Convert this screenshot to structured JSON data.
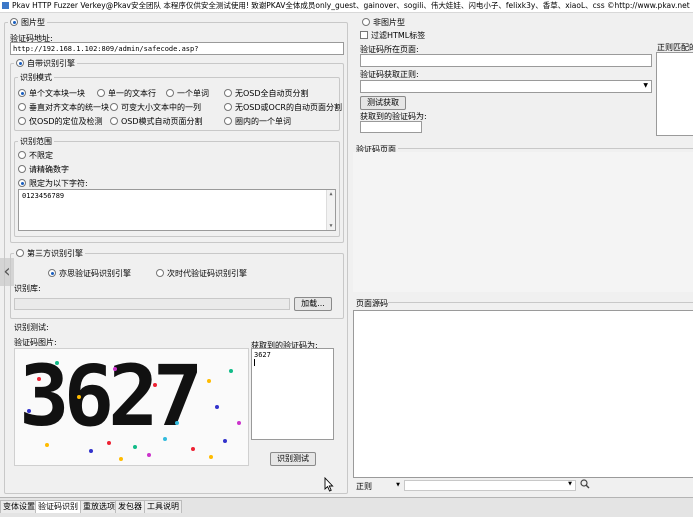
{
  "title_bar": "Pkav HTTP Fuzzer   Verkey@Pkav安全团队  本程序仅供安全测试使用!  致谢PKAV全体成员only_guest、gainover、sogili、伟大娃娃、闪电小子、felixk3y、香草、xiaoL、css  ©http://www.pkav.net",
  "left": {
    "image_type_label": "图片型",
    "captcha_url_label": "验证码地址:",
    "captcha_url_value": "http://192.168.1.102:809/admin/safecode.asp?",
    "builtin_engine_label": "自带识别引擎",
    "recog_mode_title": "识别模式",
    "modes": [
      "单个文本块一块",
      "单一的文本行",
      "一个单词",
      "无OSD全自动页分割",
      "垂直对齐文本的统一块",
      "可变大小文本中的一列",
      "无OSD或OCR的自动页面分割",
      "仅OSD的定位及检测",
      "OSD模式自动页面分割",
      "圈内的一个单词"
    ],
    "range_title": "识别范围",
    "range_options": [
      "不限定",
      "请精确数字",
      "限定为以下字符:"
    ],
    "range_chars": "0123456789",
    "third_party_label": "第三方识别引擎",
    "third_party_options": [
      "亦思验证码识别引擎",
      "次时代验证码识别引擎"
    ],
    "recog_lib_label": "识别库:",
    "load_button": "加载...",
    "recog_test_label": "识别测试:",
    "captcha_image_label": "验证码图片:",
    "captcha_digits": "3627",
    "result_label": "获取到的验证码为:",
    "result_value": "3627",
    "recog_test_button": "识别测试"
  },
  "right": {
    "non_image_label": "非图片型",
    "filter_html_label": "过滤HTML标签",
    "page_label": "验证码所在页面:",
    "regex_label": "验证码获取正则:",
    "regex_match_label": "正则匹配的",
    "test_button": "测试获取",
    "fetched_label": "获取到的验证码为:",
    "captcha_page_title": "验证码页面",
    "page_source_title": "页面源码",
    "regex_dropdown": "正则"
  },
  "tabs": [
    "变体设置",
    "验证码识别",
    "重放选项",
    "发包器",
    "工具说明"
  ],
  "active_tab": 1,
  "colors": {
    "accent": "#1a5fc0",
    "panel": "#f0f0f0"
  }
}
